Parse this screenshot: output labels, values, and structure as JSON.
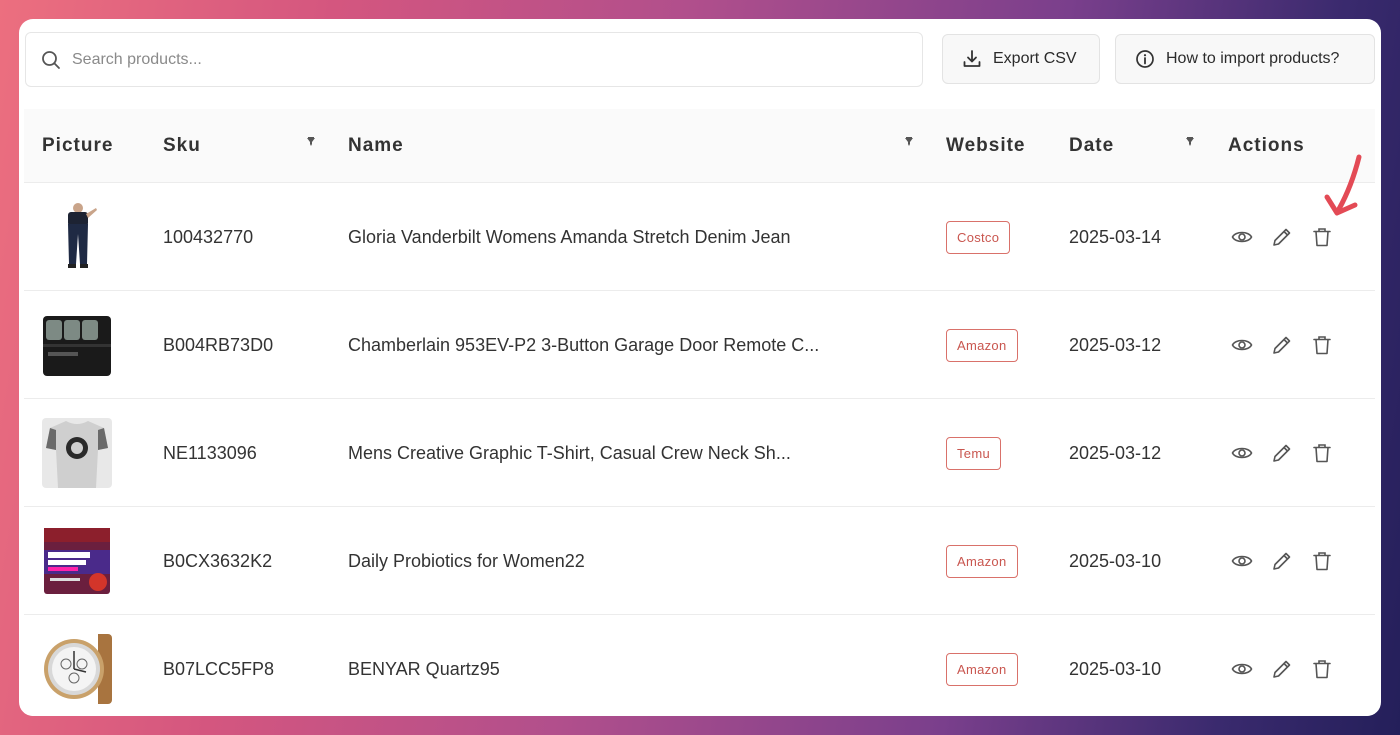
{
  "search": {
    "placeholder": "Search products..."
  },
  "toolbar": {
    "export_label": "Export CSV",
    "howto_label": "How to import products?"
  },
  "columns": {
    "picture": "Picture",
    "sku": "Sku",
    "name": "Name",
    "website": "Website",
    "date": "Date",
    "actions": "Actions"
  },
  "rows": [
    {
      "sku": "100432770",
      "name": "Gloria Vanderbilt Womens Amanda Stretch Denim Jean",
      "website": "Costco",
      "date": "2025-03-14",
      "picture": "jeans-photo"
    },
    {
      "sku": "B004RB73D0",
      "name": "Chamberlain 953EV-P2 3-Button Garage Door Remote C...",
      "website": "Amazon",
      "date": "2025-03-12",
      "picture": "garage-remote-photo"
    },
    {
      "sku": "NE1133096",
      "name": "Mens Creative Graphic T-Shirt, Casual Crew Neck Sh...",
      "website": "Temu",
      "date": "2025-03-12",
      "picture": "tshirt-photo"
    },
    {
      "sku": "B0CX3632K2",
      "name": "Daily Probiotics for Women22",
      "website": "Amazon",
      "date": "2025-03-10",
      "picture": "probiotic-box-photo"
    },
    {
      "sku": "B07LCC5FP8",
      "name": "BENYAR Quartz95",
      "website": "Amazon",
      "date": "2025-03-10",
      "picture": "watch-photo"
    }
  ],
  "colors": {
    "accent": "#d9716a",
    "arrow": "#e34a55"
  }
}
